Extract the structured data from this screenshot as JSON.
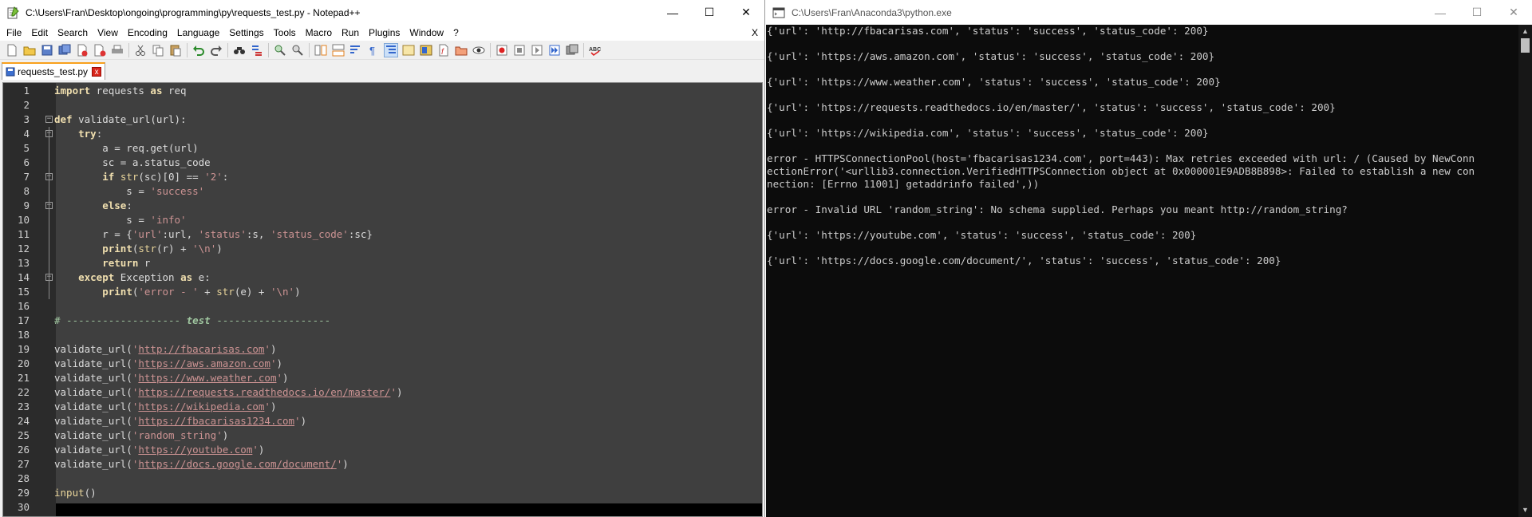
{
  "notepad": {
    "title": "C:\\Users\\Fran\\Desktop\\ongoing\\programming\\py\\requests_test.py - Notepad++",
    "controls": {
      "minimize": "—",
      "maximize": "☐",
      "close": "✕"
    },
    "menu": [
      "File",
      "Edit",
      "Search",
      "View",
      "Encoding",
      "Language",
      "Settings",
      "Tools",
      "Macro",
      "Run",
      "Plugins",
      "Window",
      "?"
    ],
    "menu_close": "X",
    "tab": {
      "label": "requests_test.py",
      "close": "x"
    },
    "lines": [
      {
        "n": "1"
      },
      {
        "n": "2"
      },
      {
        "n": "3"
      },
      {
        "n": "4"
      },
      {
        "n": "5"
      },
      {
        "n": "6"
      },
      {
        "n": "7"
      },
      {
        "n": "8"
      },
      {
        "n": "9"
      },
      {
        "n": "10"
      },
      {
        "n": "11"
      },
      {
        "n": "12"
      },
      {
        "n": "13"
      },
      {
        "n": "14"
      },
      {
        "n": "15"
      },
      {
        "n": "16"
      },
      {
        "n": "17"
      },
      {
        "n": "18"
      },
      {
        "n": "19"
      },
      {
        "n": "20"
      },
      {
        "n": "21"
      },
      {
        "n": "22"
      },
      {
        "n": "23"
      },
      {
        "n": "24"
      },
      {
        "n": "25"
      },
      {
        "n": "26"
      },
      {
        "n": "27"
      },
      {
        "n": "28"
      },
      {
        "n": "29"
      },
      {
        "n": "30"
      }
    ],
    "code": [
      [
        {
          "t": "import",
          "c": "kw"
        },
        {
          "t": " requests "
        },
        {
          "t": "as",
          "c": "kw"
        },
        {
          "t": " req"
        }
      ],
      [],
      [
        {
          "t": "def",
          "c": "kw"
        },
        {
          "t": " validate_url(url):"
        }
      ],
      [
        {
          "t": "    "
        },
        {
          "t": "try",
          "c": "kw"
        },
        {
          "t": ":"
        }
      ],
      [
        {
          "t": "        a = req.get(url)"
        }
      ],
      [
        {
          "t": "        sc = a.status_code"
        }
      ],
      [
        {
          "t": "        "
        },
        {
          "t": "if",
          "c": "kw"
        },
        {
          "t": " "
        },
        {
          "t": "str",
          "c": "bi"
        },
        {
          "t": "(sc)[0] == "
        },
        {
          "t": "'2'",
          "c": "str"
        },
        {
          "t": ":"
        }
      ],
      [
        {
          "t": "            s = "
        },
        {
          "t": "'success'",
          "c": "str"
        }
      ],
      [
        {
          "t": "        "
        },
        {
          "t": "else",
          "c": "kw"
        },
        {
          "t": ":"
        }
      ],
      [
        {
          "t": "            s = "
        },
        {
          "t": "'info'",
          "c": "str"
        }
      ],
      [
        {
          "t": "        r = {"
        },
        {
          "t": "'url'",
          "c": "str"
        },
        {
          "t": ":url, "
        },
        {
          "t": "'status'",
          "c": "str"
        },
        {
          "t": ":s, "
        },
        {
          "t": "'status_code'",
          "c": "str"
        },
        {
          "t": ":sc}"
        }
      ],
      [
        {
          "t": "        "
        },
        {
          "t": "print",
          "c": "kw"
        },
        {
          "t": "("
        },
        {
          "t": "str",
          "c": "bi"
        },
        {
          "t": "(r) + "
        },
        {
          "t": "'\\n'",
          "c": "str"
        },
        {
          "t": ")"
        }
      ],
      [
        {
          "t": "        "
        },
        {
          "t": "return",
          "c": "kw"
        },
        {
          "t": " r"
        }
      ],
      [
        {
          "t": "    "
        },
        {
          "t": "except",
          "c": "kw"
        },
        {
          "t": " Exception "
        },
        {
          "t": "as",
          "c": "kw"
        },
        {
          "t": " e:"
        }
      ],
      [
        {
          "t": "        "
        },
        {
          "t": "print",
          "c": "kw"
        },
        {
          "t": "("
        },
        {
          "t": "'error - '",
          "c": "str"
        },
        {
          "t": " + "
        },
        {
          "t": "str",
          "c": "bi"
        },
        {
          "t": "(e) + "
        },
        {
          "t": "'\\n'",
          "c": "str"
        },
        {
          "t": ")"
        }
      ],
      [],
      [
        {
          "t": "# ------------------- ",
          "c": "cm"
        },
        {
          "t": "test",
          "c": "cmb"
        },
        {
          "t": " -------------------",
          "c": "cm"
        }
      ],
      [],
      [
        {
          "t": "validate_url("
        },
        {
          "t": "'",
          "c": "str"
        },
        {
          "t": "http://fbacarisas.com",
          "c": "url"
        },
        {
          "t": "'",
          "c": "str"
        },
        {
          "t": ")"
        }
      ],
      [
        {
          "t": "validate_url("
        },
        {
          "t": "'",
          "c": "str"
        },
        {
          "t": "https://aws.amazon.com",
          "c": "url"
        },
        {
          "t": "'",
          "c": "str"
        },
        {
          "t": ")"
        }
      ],
      [
        {
          "t": "validate_url("
        },
        {
          "t": "'",
          "c": "str"
        },
        {
          "t": "https://www.weather.com",
          "c": "url"
        },
        {
          "t": "'",
          "c": "str"
        },
        {
          "t": ")"
        }
      ],
      [
        {
          "t": "validate_url("
        },
        {
          "t": "'",
          "c": "str"
        },
        {
          "t": "https://requests.readthedocs.io/en/master/",
          "c": "url"
        },
        {
          "t": "'",
          "c": "str"
        },
        {
          "t": ")"
        }
      ],
      [
        {
          "t": "validate_url("
        },
        {
          "t": "'",
          "c": "str"
        },
        {
          "t": "https://wikipedia.com",
          "c": "url"
        },
        {
          "t": "'",
          "c": "str"
        },
        {
          "t": ")"
        }
      ],
      [
        {
          "t": "validate_url("
        },
        {
          "t": "'",
          "c": "str"
        },
        {
          "t": "https://fbacarisas1234.com",
          "c": "url"
        },
        {
          "t": "'",
          "c": "str"
        },
        {
          "t": ")"
        }
      ],
      [
        {
          "t": "validate_url("
        },
        {
          "t": "'random_string'",
          "c": "str"
        },
        {
          "t": ")"
        }
      ],
      [
        {
          "t": "validate_url("
        },
        {
          "t": "'",
          "c": "str"
        },
        {
          "t": "https://youtube.com",
          "c": "url"
        },
        {
          "t": "'",
          "c": "str"
        },
        {
          "t": ")"
        }
      ],
      [
        {
          "t": "validate_url("
        },
        {
          "t": "'",
          "c": "str"
        },
        {
          "t": "https://docs.google.com/document/",
          "c": "url"
        },
        {
          "t": "'",
          "c": "str"
        },
        {
          "t": ")"
        }
      ],
      [],
      [
        {
          "t": "input",
          "c": "bi"
        },
        {
          "t": "()"
        }
      ],
      []
    ]
  },
  "console": {
    "title": "C:\\Users\\Fran\\Anaconda3\\python.exe",
    "controls": {
      "minimize": "—",
      "maximize": "☐",
      "close": "✕"
    },
    "lines": [
      "{'url': 'http://fbacarisas.com', 'status': 'success', 'status_code': 200}",
      "",
      "{'url': 'https://aws.amazon.com', 'status': 'success', 'status_code': 200}",
      "",
      "{'url': 'https://www.weather.com', 'status': 'success', 'status_code': 200}",
      "",
      "{'url': 'https://requests.readthedocs.io/en/master/', 'status': 'success', 'status_code': 200}",
      "",
      "{'url': 'https://wikipedia.com', 'status': 'success', 'status_code': 200}",
      "",
      "error - HTTPSConnectionPool(host='fbacarisas1234.com', port=443): Max retries exceeded with url: / (Caused by NewConn",
      "ectionError('<urllib3.connection.VerifiedHTTPSConnection object at 0x000001E9ADB8B898>: Failed to establish a new con",
      "nection: [Errno 11001] getaddrinfo failed',))",
      "",
      "error - Invalid URL 'random_string': No schema supplied. Perhaps you meant http://random_string?",
      "",
      "{'url': 'https://youtube.com', 'status': 'success', 'status_code': 200}",
      "",
      "{'url': 'https://docs.google.com/document/', 'status': 'success', 'status_code': 200}"
    ]
  }
}
